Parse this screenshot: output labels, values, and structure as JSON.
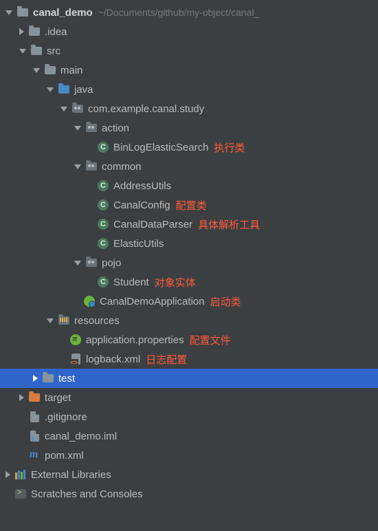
{
  "tree": [
    {
      "depth": 0,
      "arrow": "down",
      "icon": "folder",
      "label": "canal_demo",
      "bold": true,
      "path": "~/Documents/github/my-object/canal_"
    },
    {
      "depth": 1,
      "arrow": "right",
      "icon": "folder",
      "label": ".idea"
    },
    {
      "depth": 1,
      "arrow": "down",
      "icon": "folder",
      "label": "src"
    },
    {
      "depth": 2,
      "arrow": "down",
      "icon": "folder",
      "label": "main"
    },
    {
      "depth": 3,
      "arrow": "down",
      "icon": "folder-blue",
      "label": "java"
    },
    {
      "depth": 4,
      "arrow": "down",
      "icon": "pkg",
      "label": "com.example.canal.study"
    },
    {
      "depth": 5,
      "arrow": "down",
      "icon": "pkg",
      "label": "action"
    },
    {
      "depth": 6,
      "arrow": "none",
      "icon": "class",
      "label": "BinLogElasticSearch",
      "annot": "执行类"
    },
    {
      "depth": 5,
      "arrow": "down",
      "icon": "pkg",
      "label": "common"
    },
    {
      "depth": 6,
      "arrow": "none",
      "icon": "class",
      "label": "AddressUtils"
    },
    {
      "depth": 6,
      "arrow": "none",
      "icon": "class",
      "label": "CanalConfig",
      "annot": "配置类"
    },
    {
      "depth": 6,
      "arrow": "none",
      "icon": "class",
      "label": "CanalDataParser",
      "annot": "具体解析工具"
    },
    {
      "depth": 6,
      "arrow": "none",
      "icon": "class",
      "label": "ElasticUtils"
    },
    {
      "depth": 5,
      "arrow": "down",
      "icon": "pkg",
      "label": "pojo"
    },
    {
      "depth": 6,
      "arrow": "none",
      "icon": "class",
      "label": "Student",
      "annot": "对象实体"
    },
    {
      "depth": 5,
      "arrow": "none",
      "icon": "spring",
      "label": "CanalDemoApplication",
      "annot": "启动类"
    },
    {
      "depth": 3,
      "arrow": "down",
      "icon": "res",
      "label": "resources"
    },
    {
      "depth": 4,
      "arrow": "none",
      "icon": "prop",
      "label": "application.properties",
      "annot": "配置文件"
    },
    {
      "depth": 4,
      "arrow": "none",
      "icon": "xml",
      "label": "logback.xml",
      "annot": "日志配置"
    },
    {
      "depth": 2,
      "arrow": "right",
      "icon": "folder",
      "label": "test",
      "selected": true
    },
    {
      "depth": 1,
      "arrow": "right",
      "icon": "folder-orange",
      "label": "target"
    },
    {
      "depth": 1,
      "arrow": "none",
      "icon": "file",
      "label": ".gitignore"
    },
    {
      "depth": 1,
      "arrow": "none",
      "icon": "iml",
      "label": "canal_demo.iml"
    },
    {
      "depth": 1,
      "arrow": "none",
      "icon": "maven",
      "label": "pom.xml"
    },
    {
      "depth": 0,
      "arrow": "right",
      "icon": "lib",
      "label": "External Libraries"
    },
    {
      "depth": 0,
      "arrow": "none",
      "icon": "scratch",
      "label": "Scratches and Consoles"
    }
  ]
}
